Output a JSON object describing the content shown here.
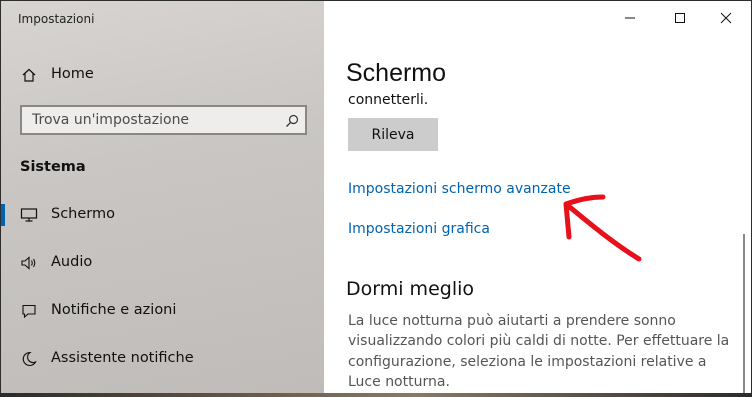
{
  "window": {
    "title": "Impostazioni"
  },
  "sidebar": {
    "home_label": "Home",
    "search_placeholder": "Trova un'impostazione",
    "section_label": "Sistema",
    "items": [
      {
        "label": "Schermo",
        "icon": "monitor-icon",
        "active": true
      },
      {
        "label": "Audio",
        "icon": "speaker-icon"
      },
      {
        "label": "Notifiche e azioni",
        "icon": "notification-icon"
      },
      {
        "label": "Assistente notifiche",
        "icon": "moon-icon"
      }
    ]
  },
  "main": {
    "title": "Schermo",
    "cut_text": "connetterli.",
    "detect_button": "Rileva",
    "link_advanced": "Impostazioni schermo avanzate",
    "link_graphics": "Impostazioni grafica",
    "section_title": "Dormi meglio",
    "section_text": "La luce notturna può aiutarti a prendere sonno visualizzando colori più caldi di notte. Per effettuare la configurazione, seleziona le impostazioni relative a Luce notturna."
  },
  "colors": {
    "accent": "#0063b1",
    "annotation": "#e8101a"
  }
}
